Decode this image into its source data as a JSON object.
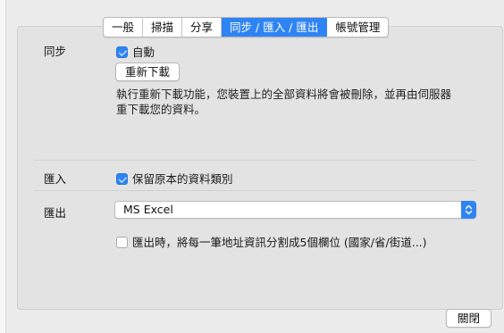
{
  "tabs": [
    {
      "label": "一般",
      "active": false
    },
    {
      "label": "掃描",
      "active": false
    },
    {
      "label": "分享",
      "active": false
    },
    {
      "label": "同步 / 匯入 / 匯出",
      "active": true
    },
    {
      "label": "帳號管理",
      "active": false
    }
  ],
  "sync": {
    "section_label": "同步",
    "auto_label": "自動",
    "auto_checked": true,
    "redownload_button": "重新下載",
    "description_line1": "執行重新下載功能，您裝置上的全部資料將會被刪除，並再由伺服器",
    "description_line2": "重下載您的資料。"
  },
  "import": {
    "section_label": "匯入",
    "keep_category_label": "保留原本的資料類別",
    "keep_category_checked": true
  },
  "export": {
    "section_label": "匯出",
    "format_value": "MS Excel",
    "split_address_label": "匯出時，將每一筆地址資訊分割成5個欄位 (國家/省/街道...)",
    "split_address_checked": false
  },
  "footer": {
    "close_button": "關閉"
  },
  "colors": {
    "accent": "#2f84f4",
    "window_bg": "#ececec",
    "panel_bg": "#e3e3e3"
  }
}
